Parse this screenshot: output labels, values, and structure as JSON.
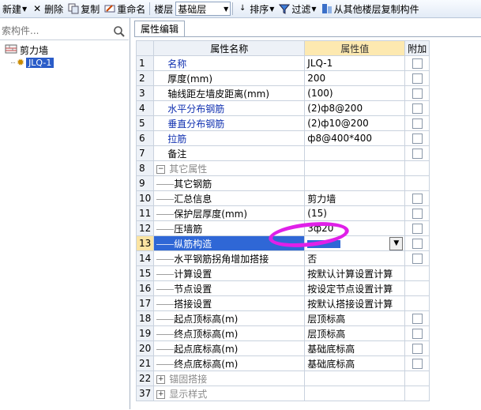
{
  "toolbar": {
    "new_label": "新建",
    "delete_label": "删除",
    "copy_label": "复制",
    "rename_label": "重命名",
    "floor_label": "楼层",
    "floor_value": "基础层",
    "sort_label": "排序",
    "filter_label": "过滤",
    "copy_from_floor_label": "从其他楼层复制构件"
  },
  "left_panel": {
    "search_placeholder": "索构件...",
    "tree": {
      "root_label": "剪力墙",
      "child_label": "JLQ-1"
    }
  },
  "tab": {
    "label": "属性编辑"
  },
  "grid": {
    "headers": {
      "name": "属性名称",
      "value": "属性值",
      "extra": "附加"
    },
    "rows": [
      {
        "num": "1",
        "name": "名称",
        "value": "JLQ-1"
      },
      {
        "num": "2",
        "name": "厚度(mm)",
        "value": "200"
      },
      {
        "num": "3",
        "name": "轴线距左墙皮距离(mm)",
        "value": "(100)"
      },
      {
        "num": "4",
        "name": "水平分布钢筋",
        "value": "(2)ф8@200"
      },
      {
        "num": "5",
        "name": "垂直分布钢筋",
        "value": "(2)ф10@200"
      },
      {
        "num": "6",
        "name": "拉筋",
        "value": "ф8@400*400"
      },
      {
        "num": "7",
        "name": "备注",
        "value": ""
      },
      {
        "num": "8",
        "name": "其它属性",
        "value": ""
      },
      {
        "num": "9",
        "name": "其它钢筋",
        "value": ""
      },
      {
        "num": "10",
        "name": "汇总信息",
        "value": "剪力墙"
      },
      {
        "num": "11",
        "name": "保护层厚度(mm)",
        "value": "(15)"
      },
      {
        "num": "12",
        "name": "压墙筋",
        "value": "3ф20"
      },
      {
        "num": "13",
        "name": "纵筋构造",
        "value": ""
      },
      {
        "num": "14",
        "name": "水平钢筋拐角增加搭接",
        "value": "否"
      },
      {
        "num": "15",
        "name": "计算设置",
        "value": "按默认计算设置计算"
      },
      {
        "num": "16",
        "name": "节点设置",
        "value": "按设定节点设置计算"
      },
      {
        "num": "17",
        "name": "搭接设置",
        "value": "按默认搭接设置计算"
      },
      {
        "num": "18",
        "name": "起点顶标高(m)",
        "value": "层顶标高"
      },
      {
        "num": "19",
        "name": "终点顶标高(m)",
        "value": "层顶标高"
      },
      {
        "num": "20",
        "name": "起点底标高(m)",
        "value": "基础底标高"
      },
      {
        "num": "21",
        "name": "终点底标高(m)",
        "value": "基础底标高"
      },
      {
        "num": "22",
        "name": "锚固搭接",
        "value": ""
      },
      {
        "num": "37",
        "name": "显示样式",
        "value": ""
      }
    ]
  },
  "colors": {
    "selected": "#2f67d6",
    "value_header": "#fde9b0",
    "annotation": "#e020e8"
  }
}
